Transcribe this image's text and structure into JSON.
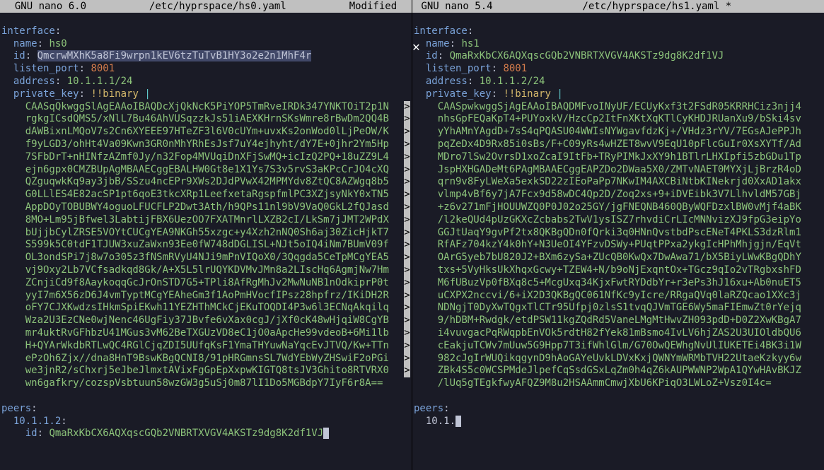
{
  "close_icon": "✕",
  "left": {
    "title_app": "  GNU nano 6.0",
    "title_file": "/etc/hyprspace/hs0.yaml",
    "title_status": "Modified  ",
    "yaml": {
      "interface_label": "interface",
      "name_label": "name",
      "name_value": "hs0",
      "id_label": "id",
      "id_value": "QmcrwMXhK5a8Fi9wrpn1kEV6tzTuTvB1HY3o2e2n1MhF4r",
      "listen_port_label": "listen_port",
      "listen_port_value": "8001",
      "address_label": "address",
      "address_value": "10.1.1.1/24",
      "private_key_label": "private_key",
      "binary_tag": "!!binary",
      "key_lines": [
        "CAASqQkwggSlAgEAAoIBAQDcXjQkNcK5PiYOP5TmRveIRDk347YNKTOiT2p1N",
        "rgkgICsdQMS5/xNlL7Bu46AhVUSqzzkJs51iAEXKHrnSKsWmre8rBwDm2QQ4B",
        "dAWBixnLMQoV7s2Cn6XYEEE97HTeZF3l6V0cUYm+uvxKs2onWod0lLjPeOW/K",
        "f9yLGD3/ohHt4Va09Kwn3GR0nMhYRhEsJsf7uY4ejhyht/dY7E+0jhr2Ym5Hp",
        "7SFbDrT+nHINfzAZmf0Jy/n32Fop4MVUqiDnXFjSwMQ+icIzQ2PQ+18uZZ9L4",
        "ejn6gpx0CMZBUpAgMBAAECggEBALHW0Gt8e1X1Ys7S3v5rvS3aKPcCrJO4cXQ",
        "QZguqwkKq9ay3jbB/SSzu4ncEPr9XWs2DJdPVwX42MPMYdv8ZtQC8AZWgq8b5",
        "G0LLlES4E82acSP1pt6qoE3tkcXRp1LeefxetaRgspfmlPC3XZjsyNkY0xTN5",
        "AppDOyTOBUBWY4oguoLFUCFLP2Dwt3Ath/h9QPs11nl9bV9VaQ0GkL2fQJasd",
        "8MO+Lm95jBfwel3LabtijFBX6UezOO7FXATMnrlLXZB2cI/LkSm7jJMT2WPdX",
        "bUjjbCylZRSE5VOYtCUCgYEA9NKGh55xzgc+y4Xzh2nNQ0Sh6aj30ZicHjkT7",
        "S599k5C0tdF1TJUW3xuZaWxn93Ee0fW748dDGLISL+NJt5oIQ4iNm7BUmV09f",
        "OL3ondSPi7j8w7o305z3fNSmRVyU4NJi9mPnVIQoX0/3Qqgda5CeTpMCgYEA5",
        "vj9Oxy2Lb7VCfsadkqd8Gk/A+X5L5lrUQYKDVMvJMn8a2LIscHq6AgmjNw7Hm",
        "ZCnjiCd9f8AaykoqqGcJrOnSTD7G5+TPli8AfRgMhJv2MwNuNB1nOdkiprP0t",
        "yyI7m6X56zD6J4vmTyptMCgYEAheGm3f1AoPmHVocfIPsz28hpfrz/IKiDH2R",
        "oFY7CJXKwdzsIHkmSpiEKwh11YEZHThMCkCjEKuTOQDI4P3w6l3ECNqAkqilq",
        "Wza2U3EzCNe0wjNenc46UgFiy37JBvfe6vXax0cgJ/jXf0cK48wHjqiW8CgYB",
        "mr4uktRvGFhbzU41MGus3vM62BeTXGUzVD8eC1jO0aApcHe99vdeoB+6Mi1lb",
        "H+QYArWkdbRTLwQC4RGlCjqZDI5UUfqKsF1YmaTHYuwNaYqcEvJTVQ/Kw+TTn",
        "ePzOh6Zjx//dna8HnT9BswKBgQCNI8/91pHRGmnsSL7WdYEbWyZHSwiF2oPGi",
        "we3jnR2/sChxrj5eJbeJlmxtAVixFgGpEpXxpwKIGTQ8tsJV3Ghito8RTVRX0",
        "wn6gafkry/cozspVsbtuun58wzGW3g5uSj0m87lI1Do5MGBdpY7IyF6r8A=="
      ],
      "peers_label": "peers",
      "peer_ip": "10.1.1.2",
      "peer_id_label": "id",
      "peer_id_value": "QmaRxKbCX6AQXqscGQb2VNBRTXVGV4AKSTz9dg8K2df1VJ"
    }
  },
  "right": {
    "title_app": " GNU nano 5.4",
    "title_file": "/etc/hyprspace/hs1.yaml *",
    "title_status": "",
    "yaml": {
      "interface_label": "interface",
      "name_label": "name",
      "name_value": "hs1",
      "id_label": "id",
      "id_value": "QmaRxKbCX6AQXqscGQb2VNBRTXVGV4AKSTz9dg8K2df1VJ",
      "listen_port_label": "listen_port",
      "listen_port_value": "8001",
      "address_label": "address",
      "address_value": "10.1.1.2/24",
      "private_key_label": "private_key",
      "binary_tag": "!!binary",
      "key_lines": [
        "CAASpwkwggSjAgEAAoIBAQDMFvoINyUF/ECUyKxf3t2FSdR05KRRHCiz3njj4",
        "nhsGpFEQaKpT4+PUYoxkV/HzcCp2ItFnXKtXqKTlCyKHDJRUanXu9/bSki4sv",
        "yYhAMnYAgdD+7sS4qPQASU04WWIsNYWgavfdzKj+/VHdz3rYV/7EGsAJePPJh",
        "pqZeDx4D9Rx85i0sBs/F+C09yRs4wHZET8wvV9EqU10pFlcGuIr0XsXYTf/Ad",
        "MDro7lSw2OvrsD1xoZcaI9ItFb+TRyPIMkJxXY9h1BTlrLHXIpfi5zbGDu1Tp",
        "JspHXHGADeMt6PAgMBAAECggEAPZDo2DWaa5X0/ZMTvNAET0MYXjLjBrzR4oD",
        "qrn9v8FyLWeXa5exkSD22zIEoPaPp7NKwIM4AXCBiNtbKINekrjd0XxAD1akx",
        "vlmp4vBf6y7jA7Fcx9d58wDC4Qp2D/Zoq2xs+9+iDVEibk3V7LlhvldM57GBj",
        "+z6v271mFjHOUUWZQ0P0J02o25GY/jgFNEQNB460QByWQFDzxlBW0vMjf4aBK",
        "/l2keQUd4pUzGKXcZcbabs2TwV1ysISZ7rhvdiCrLIcMNNvizXJ9fpG3eipYo",
        "GGJtUaqY9gvPf2tx8QKBgQDn0fQrki3q0HNnQvstbdPscENeT4PKLS3dzRlm1",
        "RfAFz704kzY4k0hY+N3UeOI4YFzvDSWy+PUqtPPxa2ykgIcHPhMhjgjn/EqVt",
        "OArG5yeb7bU820J2+BXm6zySa+ZUcQB0KwQx7DwAwa71/bX5BiyLWwKBgQDhY",
        "txs+5VyHksUkXhqxGcwy+TZEW4+N/b9oNjExqntOx+TGcz9qIo2vTRgbxshFD",
        "M6fUBuzVp0fBXq8c5+McgUxq34KjxFwtRYDdbYr+r3ePs3hJ16xu+Ab0nuET5",
        "uCXPX2nccvi/6+iX2D3QKBgQC061NfKc9yIcre/RRgaQVq0laRZQcao1XXc3j",
        "NDNgjT0DyXwTQgxTlCTr95Ufpj0zlsS1tvqQJVmTGE6Wy5maFIEmwZt0rYejq",
        "9/hDBM+Rwdgk/etdPSW11kgZQdRd5VaneLMgMtHwvZH093pdD+D0Z2XwKBgA7",
        "i4vuvgacPqRWqpbEnVOk5rdtH82fYek81mBsmo4IvLV6hjZAS2U3UIOldbQU6",
        "cEakjuTCWv7mUuw5G9Hpp7T3ifWhlGlm/G70OwQEWhgNvUlIUKETEi4BK3i1W",
        "982cJgIrWUQikqgynD9hAoGAYeUvkLDVxKxjQWNYmWRMbTVH22UtaeKzkyy6w",
        "ZBk4S5c0WCSPMdeJlpefCqSsdGSxLqZm0h4qZ6kAUPWWNP2WpA1QYwHAvBKJZ",
        "/lUq5gTEgkfwyAFQZ9M8u2HSAAmmCmwjXbU6KPiqO3LWLoZ+Vsz0I4c="
      ],
      "peers_label": "peers",
      "peer_ip_partial": "10.1."
    }
  }
}
